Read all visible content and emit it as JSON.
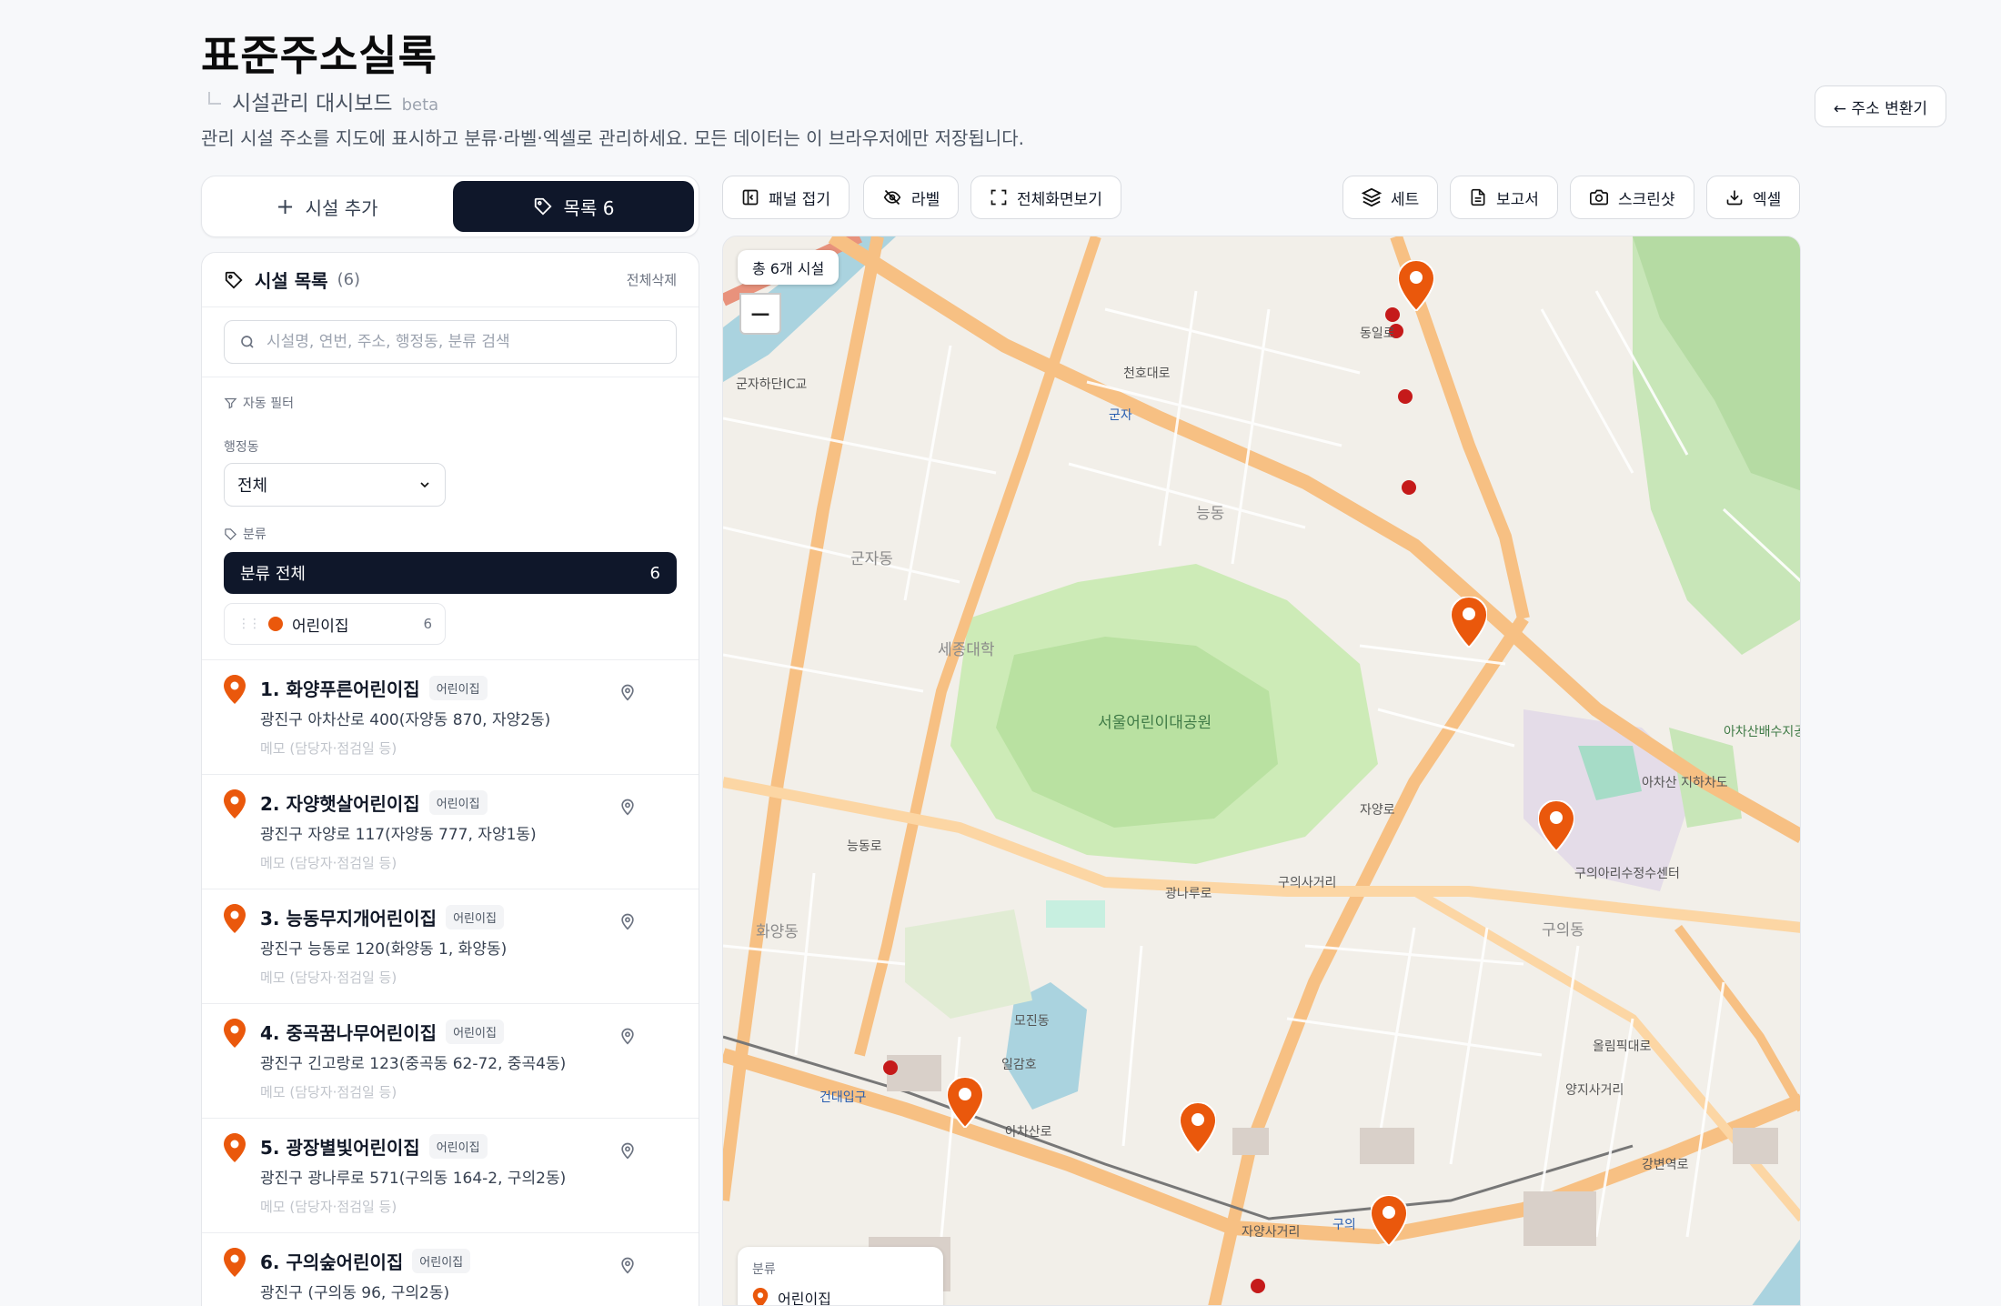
{
  "header": {
    "brand": "표준주소실록",
    "subtitle": "시설관리 대시보드",
    "beta": "beta",
    "description": "관리 시설 주소를 지도에 표시하고 분류·라벨·엑셀로 관리하세요. 모든 데이터는 이 브라우저에만 저장됩니다.",
    "converter_button": "← 주소 변환기"
  },
  "toggle": {
    "add_label": "시설 추가",
    "list_label": "목록 6"
  },
  "panel": {
    "title": "시설 목록",
    "count": "(6)",
    "delete_all": "전체삭제",
    "search_placeholder": "시설명, 연번, 주소, 행정동, 분류 검색",
    "auto_filter": "자동 필터",
    "dong_label": "행정동",
    "dong_value": "전체",
    "category_label": "분류",
    "category_all": "분류 전체",
    "category_all_count": "6",
    "category_chip": "어린이집",
    "category_chip_count": "6"
  },
  "facilities": [
    {
      "name": "1. 화양푸른어린이집",
      "badge": "어린이집",
      "address": "광진구 아차산로 400(자양동 870, 자양2동)",
      "memo": "메모 (담당자·점검일 등)"
    },
    {
      "name": "2. 자양햇살어린이집",
      "badge": "어린이집",
      "address": "광진구 자양로 117(자양동 777, 자양1동)",
      "memo": "메모 (담당자·점검일 등)"
    },
    {
      "name": "3. 능동무지개어린이집",
      "badge": "어린이집",
      "address": "광진구 능동로 120(화양동 1, 화양동)",
      "memo": "메모 (담당자·점검일 등)"
    },
    {
      "name": "4. 중곡꿈나무어린이집",
      "badge": "어린이집",
      "address": "광진구 긴고랑로 123(중곡동 62-72, 중곡4동)",
      "memo": "메모 (담당자·점검일 등)"
    },
    {
      "name": "5. 광장별빛어린이집",
      "badge": "어린이집",
      "address": "광진구 광나루로 571(구의동 164-2, 구의2동)",
      "memo": "메모 (담당자·점검일 등)"
    },
    {
      "name": "6. 구의숲어린이집",
      "badge": "어린이집",
      "address": "광진구 (구의동 96, 구의2동)",
      "memo": ""
    }
  ],
  "toolbar": {
    "collapse": "패널 접기",
    "label": "라벨",
    "fullscreen": "전체화면보기",
    "set": "세트",
    "report": "보고서",
    "screenshot": "스크린샷",
    "excel": "엑셀"
  },
  "map": {
    "count_chip": "총 6개 시설",
    "zoom_out": "−",
    "legend_title": "분류",
    "legend_item": "어린이집",
    "marker_color": "#ea580c",
    "labels": {
      "park": "서울어린이대공원",
      "sejong": "세종대학",
      "ilgamho": "일감호",
      "geonkuk": "건대입구",
      "gunja": "군자",
      "gunjadong": "군자동",
      "hwayang": "화양동",
      "neungdong": "능동",
      "mojin": "모진동",
      "guui": "구의동",
      "achasan_park": "아차산배수지공원",
      "achasan": "아차산로",
      "cheonho": "천호대로",
      "gwangnaru": "광나루로",
      "jayang": "자양로",
      "neungdongro": "능동로",
      "dongildaero": "동일로",
      "gangbyeon": "강변역로",
      "guui_center": "구의아리수정수센터",
      "olympic": "올림픽대로",
      "guui_station": "구의",
      "jayang_sagori": "자양사거리",
      "guui_sagori": "구의사거리",
      "yangji": "양지사거리",
      "gunja_ic": "군자하단IC교",
      "chunho_jiha": "아차산 지하차도"
    }
  }
}
